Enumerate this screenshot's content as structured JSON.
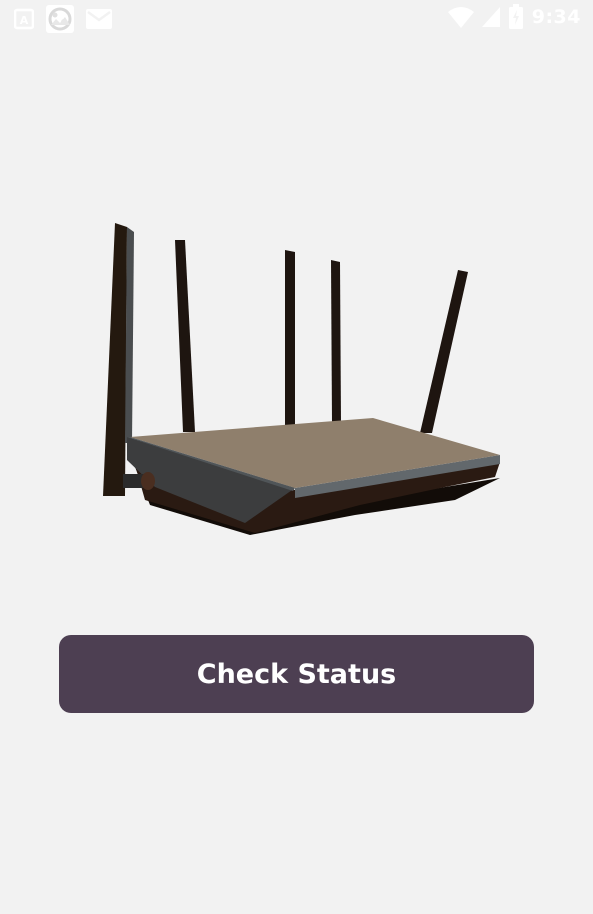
{
  "status_bar": {
    "time": "9:34",
    "left_icons": [
      "app-a-icon",
      "photo-thumbnail-icon",
      "mail-icon"
    ],
    "right_icons": [
      "wifi-icon",
      "signal-icon",
      "battery-icon"
    ],
    "icon_color": "#ffffff"
  },
  "main": {
    "illustration": "router-icon",
    "check_button_label": "Check Status"
  },
  "colors": {
    "background": "#f2f2f2",
    "button": "#4d3f52",
    "button_text": "#ffffff"
  }
}
